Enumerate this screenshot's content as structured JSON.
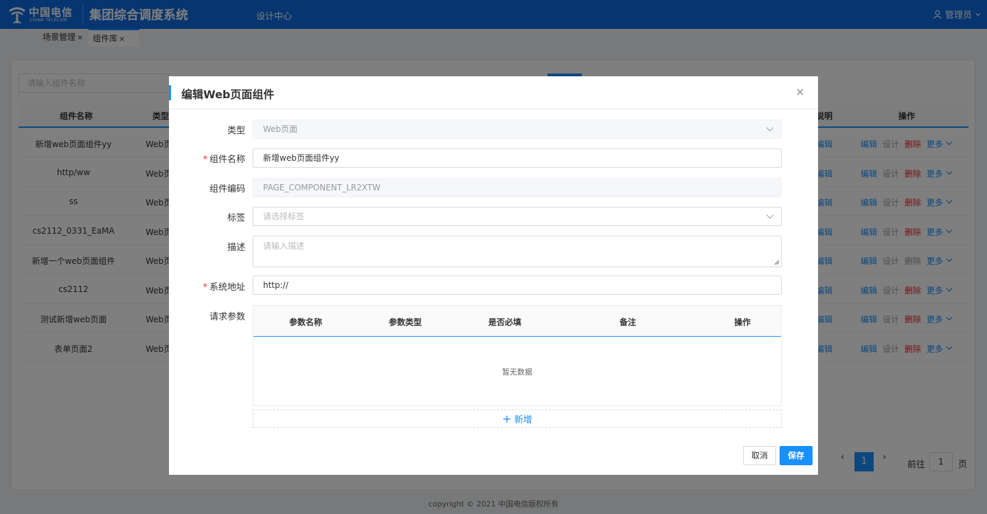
{
  "header": {
    "logo_cn": "中国电信",
    "logo_en": "CHINA TELECOM",
    "system_title": "集团综合调度系统",
    "nav_design": "设计中心",
    "user": "管理员"
  },
  "tabs": [
    {
      "label": "场景管理",
      "close": "×"
    },
    {
      "label": "组件库",
      "close": "×"
    }
  ],
  "list": {
    "search_placeholder": "请输入组件名称",
    "columns": {
      "name": "组件名称",
      "type": "类型",
      "desc": "说明",
      "ops": "操作"
    },
    "rows": [
      {
        "name": "新增web页面组件yy",
        "type": "Web页",
        "ops": {
          "edit": "编辑",
          "design": "设计",
          "delete": "删除",
          "more": "更多",
          "delete_disabled": false
        }
      },
      {
        "name": "http/ww",
        "type": "Web页",
        "ops": {
          "edit": "编辑",
          "design": "设计",
          "delete": "删除",
          "more": "更多",
          "delete_disabled": false
        }
      },
      {
        "name": "ss",
        "type": "Web页",
        "ops": {
          "edit": "编辑",
          "design": "设计",
          "delete": "删除",
          "more": "更多",
          "delete_disabled": false
        }
      },
      {
        "name": "cs2112_0331_EaMA",
        "type": "Web页",
        "ops": {
          "edit": "编辑",
          "design": "设计",
          "delete": "删除",
          "more": "更多",
          "delete_disabled": false
        }
      },
      {
        "name": "新增一个web页面组件",
        "type": "Web页",
        "ops": {
          "edit": "编辑",
          "design": "设计",
          "delete": "删除",
          "more": "更多",
          "delete_disabled": true
        }
      },
      {
        "name": "cs2112",
        "type": "Web页",
        "ops": {
          "edit": "编辑",
          "design": "设计",
          "delete": "删除",
          "more": "更多",
          "delete_disabled": false
        }
      },
      {
        "name": "测试新增web页面",
        "type": "Web页",
        "ops": {
          "edit": "编辑",
          "design": "设计",
          "delete": "删除",
          "more": "更多",
          "delete_disabled": false
        }
      },
      {
        "name": "表单页面2",
        "type": "Web页",
        "ops": {
          "edit": "编辑",
          "design": "设计",
          "delete": "删除",
          "more": "更多",
          "delete_disabled": false
        }
      }
    ],
    "side_edit_label": "编辑",
    "pagination": {
      "prev": "‹",
      "current": "1",
      "next": "›",
      "goto_prefix": "前往",
      "goto_value": "1",
      "goto_suffix": "页"
    }
  },
  "footer": "copyright © 2021 中国电信版权所有",
  "modal": {
    "title": "编辑Web页面组件",
    "close_icon": "×",
    "fields": {
      "type": {
        "label": "类型",
        "value": "Web页面"
      },
      "name": {
        "label": "组件名称",
        "value": "新增web页面组件yy",
        "required": "*"
      },
      "code": {
        "label": "组件编码",
        "value": "PAGE_COMPONENT_LR2XTW"
      },
      "tag": {
        "label": "标签",
        "placeholder": "请选择标签"
      },
      "desc": {
        "label": "描述",
        "placeholder": "请输入描述"
      },
      "url": {
        "label": "系统地址",
        "value": "http://",
        "required": "*"
      },
      "params": {
        "label": "请求参数"
      }
    },
    "param_table": {
      "columns": [
        "参数名称",
        "参数类型",
        "是否必填",
        "备注",
        "操作"
      ],
      "empty": "暂无数据"
    },
    "add_label": "新增",
    "cancel": "取消",
    "save": "保存"
  },
  "colors": {
    "primary": "#1890ff",
    "header": "#0d6ae0",
    "danger": "#f5222d"
  }
}
